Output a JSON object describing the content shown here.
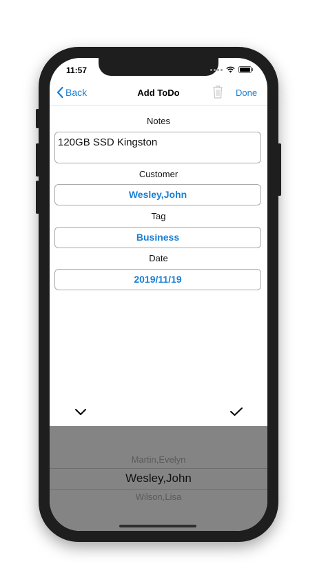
{
  "status": {
    "time": "11:57"
  },
  "nav": {
    "back_label": "Back",
    "title": "Add ToDo",
    "done_label": "Done"
  },
  "form": {
    "notes_label": "Notes",
    "notes_value": "120GB SSD Kingston",
    "customer_label": "Customer",
    "customer_value": "Wesley,John",
    "tag_label": "Tag",
    "tag_value": "Business",
    "date_label": "Date",
    "date_value": "2019/11/19"
  },
  "picker": {
    "items": [
      "Martin,Evelyn",
      "Wesley,John",
      "Wilson,Lisa"
    ],
    "selected": "Wesley,John"
  },
  "colors": {
    "accent": "#1a7fd4",
    "picker_bg": "#848484",
    "frame": "#1e1e1e"
  },
  "icons": {
    "back": "chevron-left-icon",
    "trash": "trash-icon",
    "collapse": "chevron-down-icon",
    "confirm": "checkmark-icon"
  }
}
